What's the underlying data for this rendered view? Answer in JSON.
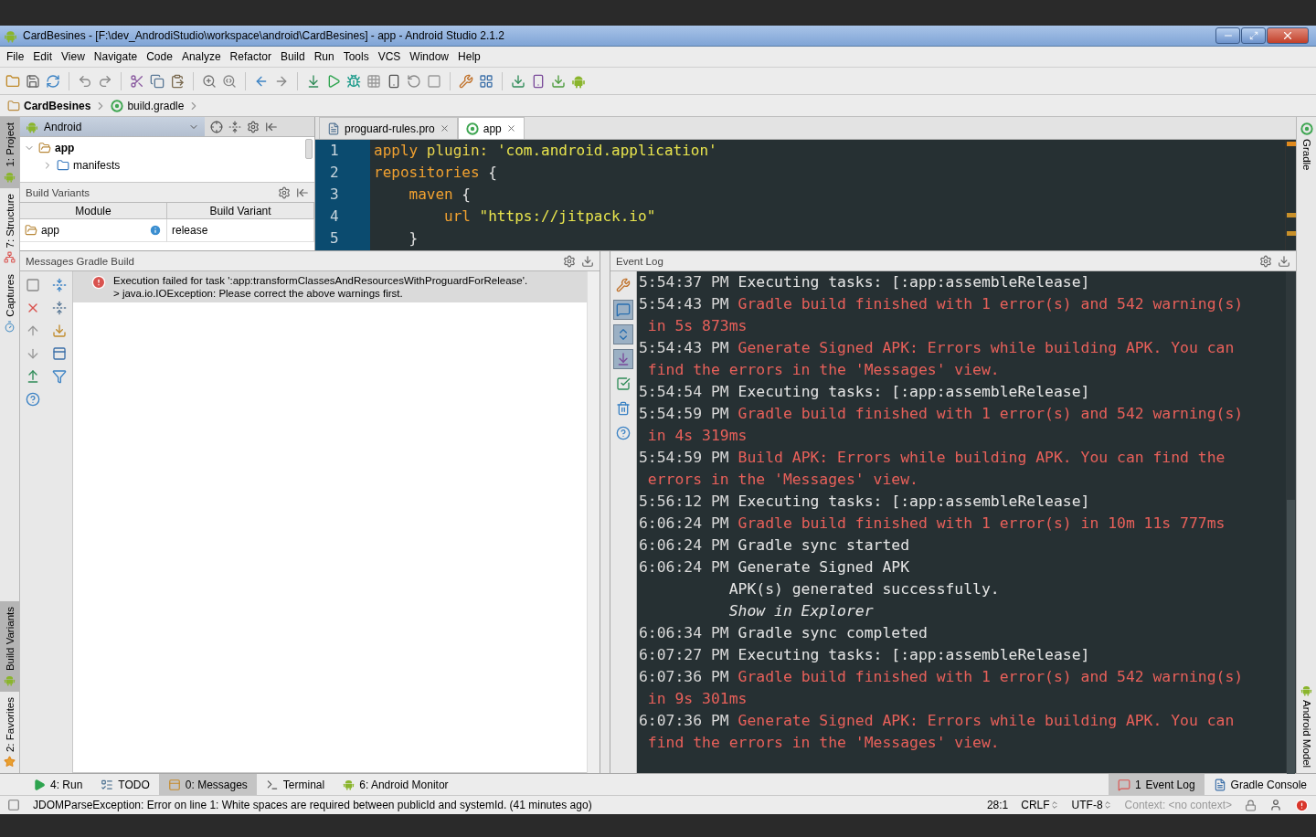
{
  "window": {
    "title": "CardBesines - [F:\\dev_AndrodiStudio\\workspace\\android\\CardBesines] - app - Android Studio 2.1.2"
  },
  "menu": [
    "File",
    "Edit",
    "View",
    "Navigate",
    "Code",
    "Analyze",
    "Refactor",
    "Build",
    "Run",
    "Tools",
    "VCS",
    "Window",
    "Help"
  ],
  "breadcrumb": [
    {
      "label": "CardBesines",
      "kind": "project"
    },
    {
      "label": "build.gradle",
      "kind": "gradle"
    }
  ],
  "left_tool_tabs": {
    "top": [
      {
        "label": "1: Project",
        "kind": "project",
        "selected": true
      },
      {
        "label": "7: Structure",
        "kind": "structure",
        "selected": false
      },
      {
        "label": "Captures",
        "kind": "captures",
        "selected": false
      }
    ],
    "bottom": [
      {
        "label": "Build Variants",
        "kind": "android",
        "selected": true
      },
      {
        "label": "2: Favorites",
        "kind": "favorites",
        "selected": false
      }
    ]
  },
  "right_tool_tabs": {
    "top": [
      {
        "label": "Gradle",
        "kind": "gradle",
        "selected": false
      }
    ],
    "bottom": [
      {
        "label": "Android Model",
        "kind": "android",
        "selected": false
      }
    ]
  },
  "project_panel": {
    "view": "Android",
    "tree": [
      {
        "label": "app",
        "kind": "module",
        "expanded": true,
        "children": [
          {
            "label": "manifests",
            "kind": "folder",
            "expanded": false
          }
        ]
      }
    ]
  },
  "build_variants": {
    "title": "Build Variants",
    "columns": [
      "Module",
      "Build Variant"
    ],
    "rows": [
      {
        "module": "app",
        "variant": "release"
      }
    ]
  },
  "editor": {
    "tabs": [
      {
        "label": "proguard-rules.pro",
        "kind": "file",
        "selected": false
      },
      {
        "label": "app",
        "kind": "gradle",
        "selected": true
      }
    ],
    "lines": [
      {
        "number": "1",
        "parts": [
          {
            "text": "apply",
            "kind": "keyword"
          },
          {
            "text": " plugin: ",
            "kind": "name"
          },
          {
            "text": "'com.android.application'",
            "kind": "string"
          }
        ]
      },
      {
        "number": "2",
        "parts": [
          {
            "text": "repositories",
            "kind": "keyword"
          },
          {
            "text": " {",
            "kind": "plain"
          }
        ]
      },
      {
        "number": "3",
        "parts": [
          {
            "text": "    maven",
            "kind": "keyword"
          },
          {
            "text": " {",
            "kind": "plain"
          }
        ]
      },
      {
        "number": "4",
        "parts": [
          {
            "text": "        url",
            "kind": "keyword"
          },
          {
            "text": " \"https://jitpack.io\"",
            "kind": "string"
          }
        ]
      },
      {
        "number": "5",
        "parts": [
          {
            "text": "    }",
            "kind": "plain"
          }
        ]
      }
    ]
  },
  "messages": {
    "title": "Messages Gradle Build",
    "items": [
      {
        "kind": "error",
        "selected": true,
        "lines": [
          "Execution failed for task ':app:transformClassesAndResourcesWithProguardForRelease'.",
          "> java.io.IOException: Please correct the above warnings first."
        ]
      }
    ]
  },
  "event_log": {
    "title": "Event Log",
    "entries": [
      {
        "time": "5:54:37 PM",
        "text": "Executing tasks: [:app:assembleRelease]",
        "kind": "info"
      },
      {
        "time": "5:54:43 PM",
        "text": "Gradle build finished with 1 error(s) and 542 warning(s) in 5s 873ms",
        "kind": "error"
      },
      {
        "time": "5:54:43 PM",
        "text": "Generate Signed APK: Errors while building APK. You can find the errors in the 'Messages' view.",
        "kind": "error"
      },
      {
        "time": "5:54:54 PM",
        "text": "Executing tasks: [:app:assembleRelease]",
        "kind": "info"
      },
      {
        "time": "5:54:59 PM",
        "text": "Gradle build finished with 1 error(s) and 542 warning(s) in 4s 319ms",
        "kind": "error"
      },
      {
        "time": "5:54:59 PM",
        "text": "Build APK: Errors while building APK. You can find the errors in the 'Messages' view.",
        "kind": "error"
      },
      {
        "time": "5:56:12 PM",
        "text": "Executing tasks: [:app:assembleRelease]",
        "kind": "info"
      },
      {
        "time": "6:06:24 PM",
        "text": "Gradle build finished with 1 error(s) in 10m 11s 777ms",
        "kind": "error"
      },
      {
        "time": "6:06:24 PM",
        "text": "Gradle sync started",
        "kind": "info"
      },
      {
        "time": "6:06:24 PM",
        "text": "Generate Signed APK",
        "kind": "info",
        "details": [
          "APK(s) generated successfully."
        ],
        "link": "Show in Explorer"
      },
      {
        "time": "6:06:34 PM",
        "text": "Gradle sync completed",
        "kind": "info"
      },
      {
        "time": "6:07:27 PM",
        "text": "Executing tasks: [:app:assembleRelease]",
        "kind": "info"
      },
      {
        "time": "6:07:36 PM",
        "text": "Gradle build finished with 1 error(s) and 542 warning(s) in 9s 301ms",
        "kind": "error"
      },
      {
        "time": "6:07:36 PM",
        "text": "Generate Signed APK: Errors while building APK. You can find the errors in the 'Messages' view.",
        "kind": "error"
      }
    ]
  },
  "bottom_tabs": {
    "left": [
      {
        "label": "4: Run",
        "kind": "run",
        "selected": false
      },
      {
        "label": "TODO",
        "kind": "todo",
        "selected": false
      },
      {
        "label": "0: Messages",
        "kind": "messages",
        "selected": true
      },
      {
        "label": "Terminal",
        "kind": "terminal",
        "selected": false
      },
      {
        "label": "6: Android Monitor",
        "kind": "android",
        "selected": false
      }
    ],
    "right": [
      {
        "label": "Event Log",
        "badge": "1",
        "kind": "event_log",
        "selected": true
      },
      {
        "label": "Gradle Console",
        "kind": "console",
        "selected": false
      }
    ]
  },
  "status_bar": {
    "message": "JDOMParseException: Error on line 1: White spaces are required between publicId and systemId. (41 minutes ago)",
    "position": "28:1",
    "line_separator": "CRLF",
    "encoding": "UTF-8",
    "context": "Context: <no context>"
  }
}
